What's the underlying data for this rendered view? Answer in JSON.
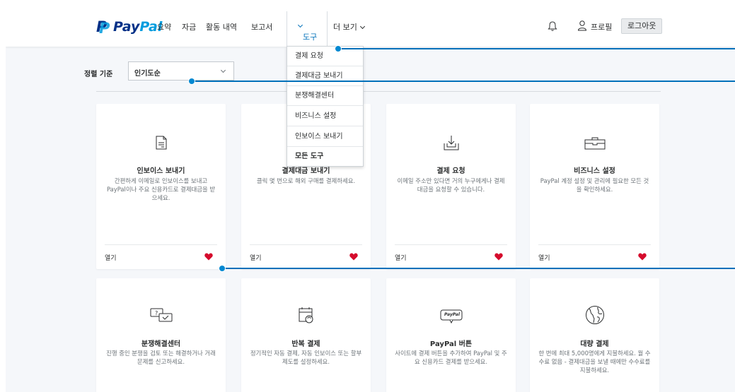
{
  "brand": {
    "pay": "Pay",
    "pal": "Pal",
    "mark": "P"
  },
  "nav": {
    "summary": "요약",
    "funds": "자금",
    "activity": "활동 내역",
    "reports": "보고서",
    "tools": "도구",
    "more": "더 보기",
    "profile": "프로필",
    "logout": "로그아웃"
  },
  "sort": {
    "label": "정렬 기준",
    "value": "인기도순"
  },
  "dropdown": {
    "items": [
      "결제 요청",
      "결제대금 보내기",
      "분쟁해결센터",
      "비즈니스 설정",
      "인보이스 보내기",
      "모든 도구"
    ]
  },
  "cards_row1": [
    {
      "icon": "invoice-icon",
      "title": "인보이스 보내기",
      "desc": "간편하게 이메일로 인보이스를 보내고 PayPal이나 주요 신용카드로 결제대금을 받으세요.",
      "open": "열기"
    },
    {
      "icon": "send-money-icon",
      "title": "결제대금 보내기",
      "desc": "클릭 몇 번으로 해외 구매를 결제하세요.",
      "open": "열기"
    },
    {
      "icon": "request-payment-icon",
      "title": "결제 요청",
      "desc": "이메일 주소만 있다면 거의 누구에게나 결제대금을 요청할 수 있습니다.",
      "open": "열기"
    },
    {
      "icon": "briefcase-icon",
      "title": "비즈니스 설정",
      "desc": "PayPal 계정 설정 및 관리에 필요한 모든 것을 확인하세요.",
      "open": "열기"
    }
  ],
  "cards_row2": [
    {
      "icon": "dispute-chat-icon",
      "title": "분쟁해결센터",
      "desc": "진행 중인 분쟁을 검토 또는 해결하거나 거래문제를 신고하세요."
    },
    {
      "icon": "recurring-calendar-icon",
      "title": "반복 결제",
      "desc": "정기적인 자동 결제, 자동 인보이스 또는 할부 제도를 설정하세요."
    },
    {
      "icon": "paypal-button-icon",
      "title": "PayPal 버튼",
      "desc": "사이트에 결제 버튼을 추가하여 PayPal 및 주요 신용카드 결제를 받으세요.",
      "badge": "PayPal"
    },
    {
      "icon": "globe-icon",
      "title": "대량 결제",
      "desc": "한 번에 최대 5,000명에게 지불하세요. 월 수수료 없음 - 결제대금을 보낼 때에만 수수료를 지불하세요."
    }
  ],
  "colors": {
    "brand_dark": "#003087",
    "brand_light": "#009cde",
    "accent": "#0070ba",
    "heart": "#d50b2c"
  }
}
